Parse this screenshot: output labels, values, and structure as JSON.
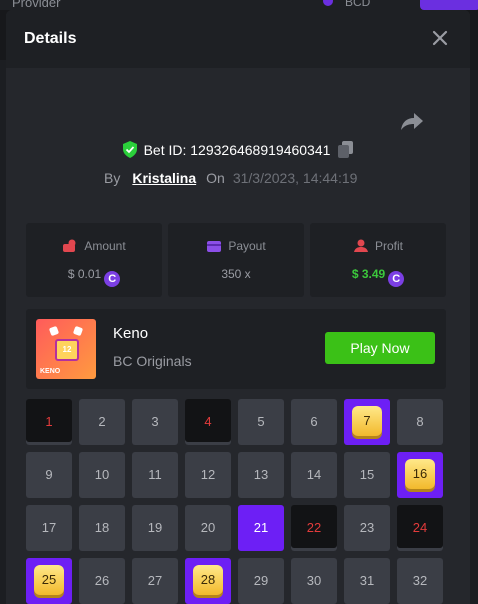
{
  "background": {
    "provider_label": "Provider",
    "currency": "BCD"
  },
  "modal": {
    "title": "Details",
    "bet_id_label": "Bet ID:",
    "bet_id": "129326468919460341",
    "by_label": "By",
    "username": "Kristalina",
    "on_label": "On",
    "datetime": "31/3/2023, 14:44:19"
  },
  "stats": {
    "amount_label": "Amount",
    "amount_value": "$ 0.01",
    "payout_label": "Payout",
    "payout_value": "350 x",
    "profit_label": "Profit",
    "profit_value": "$ 3.49",
    "coin_glyph": "C"
  },
  "game": {
    "name": "Keno",
    "provider": "BC Originals",
    "play_button": "Play Now",
    "thumb_tile": "12",
    "thumb_name": "KENO"
  },
  "colors": {
    "accent": "#6d1ff5",
    "play_green": "#3bc117",
    "miss_red": "#e23b3b",
    "profit_green": "#3cc93c"
  },
  "keno_grid": [
    {
      "n": "1",
      "state": "miss"
    },
    {
      "n": "2",
      "state": "normal"
    },
    {
      "n": "3",
      "state": "normal"
    },
    {
      "n": "4",
      "state": "miss"
    },
    {
      "n": "5",
      "state": "normal"
    },
    {
      "n": "6",
      "state": "normal"
    },
    {
      "n": "7",
      "state": "hit"
    },
    {
      "n": "8",
      "state": "normal"
    },
    {
      "n": "9",
      "state": "normal"
    },
    {
      "n": "10",
      "state": "normal"
    },
    {
      "n": "11",
      "state": "normal"
    },
    {
      "n": "12",
      "state": "normal"
    },
    {
      "n": "13",
      "state": "normal"
    },
    {
      "n": "14",
      "state": "normal"
    },
    {
      "n": "15",
      "state": "normal"
    },
    {
      "n": "16",
      "state": "hit"
    },
    {
      "n": "17",
      "state": "normal"
    },
    {
      "n": "18",
      "state": "normal"
    },
    {
      "n": "19",
      "state": "normal"
    },
    {
      "n": "20",
      "state": "normal"
    },
    {
      "n": "21",
      "state": "selected"
    },
    {
      "n": "22",
      "state": "miss"
    },
    {
      "n": "23",
      "state": "normal"
    },
    {
      "n": "24",
      "state": "miss"
    },
    {
      "n": "25",
      "state": "hit"
    },
    {
      "n": "26",
      "state": "normal"
    },
    {
      "n": "27",
      "state": "normal"
    },
    {
      "n": "28",
      "state": "hit"
    },
    {
      "n": "29",
      "state": "normal"
    },
    {
      "n": "30",
      "state": "normal"
    },
    {
      "n": "31",
      "state": "normal"
    },
    {
      "n": "32",
      "state": "normal"
    }
  ]
}
